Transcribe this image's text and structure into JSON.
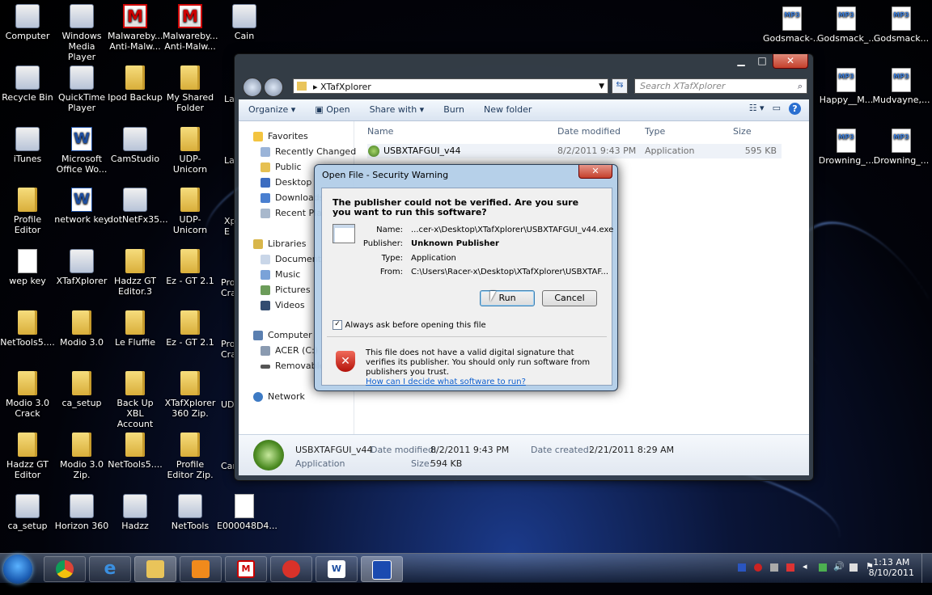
{
  "desktop": {
    "icons": [
      {
        "label": "Computer",
        "kind": "app"
      },
      {
        "label": "Windows Media Player",
        "kind": "app"
      },
      {
        "label": "Malwareby... Anti-Malw...",
        "kind": "red"
      },
      {
        "label": "Malwareby... Anti-Malw...",
        "kind": "red"
      },
      {
        "label": "Cain",
        "kind": "app"
      },
      {
        "label": "Recycle Bin",
        "kind": "app"
      },
      {
        "label": "QuickTime Player",
        "kind": "app"
      },
      {
        "label": "Ipod Backup",
        "kind": "folder"
      },
      {
        "label": "My Shared Folder",
        "kind": "folder"
      },
      {
        "label": "iTunes",
        "kind": "app"
      },
      {
        "label": "Microsoft Office Wo...",
        "kind": "word"
      },
      {
        "label": "CamStudio",
        "kind": "app"
      },
      {
        "label": "UDP-Unicorn",
        "kind": "folder"
      },
      {
        "label": "Profile Editor",
        "kind": "folder"
      },
      {
        "label": "network key",
        "kind": "word"
      },
      {
        "label": "dotNetFx35...",
        "kind": "app"
      },
      {
        "label": "UDP-Unicorn",
        "kind": "folder"
      },
      {
        "label": "wep key",
        "kind": "doc"
      },
      {
        "label": "XTafXplorer",
        "kind": "app"
      },
      {
        "label": "Hadzz GT Editor.3",
        "kind": "folder"
      },
      {
        "label": "Ez - GT 2.1",
        "kind": "folder"
      },
      {
        "label": "NetTools5....",
        "kind": "folder"
      },
      {
        "label": "Modio 3.0",
        "kind": "folder"
      },
      {
        "label": "Le Fluffie",
        "kind": "folder"
      },
      {
        "label": "Ez - GT 2.1",
        "kind": "folder"
      },
      {
        "label": "Modio 3.0 Crack",
        "kind": "folder"
      },
      {
        "label": "ca_setup",
        "kind": "folder"
      },
      {
        "label": "Back Up XBL Account",
        "kind": "folder"
      },
      {
        "label": "XTafXplorer 360 Zip.",
        "kind": "folder"
      },
      {
        "label": "Hadzz GT Editor",
        "kind": "folder"
      },
      {
        "label": "Modio 3.0 Zip.",
        "kind": "folder"
      },
      {
        "label": "NetTools5....",
        "kind": "folder"
      },
      {
        "label": "Profile Editor Zip.",
        "kind": "folder"
      },
      {
        "label": "ca_setup",
        "kind": "app"
      },
      {
        "label": "Horizon 360",
        "kind": "app"
      },
      {
        "label": "Hadzz",
        "kind": "app"
      },
      {
        "label": "NetTools",
        "kind": "app"
      },
      {
        "label": "E000048D4...",
        "kind": "doc"
      }
    ],
    "partial_labels": [
      "La",
      "La",
      "Xp E",
      "Pro Cra",
      "Pro Cra",
      "UD",
      "Car"
    ],
    "right_icons": [
      {
        "label": "Godsmack-..."
      },
      {
        "label": "Godsmack_..."
      },
      {
        "label": "Godsmack..."
      },
      {
        "label": "Happy__M..."
      },
      {
        "label": "Mudvayne,..."
      },
      {
        "label": "Drowning_..."
      },
      {
        "label": "Drowning_..."
      }
    ]
  },
  "explorer": {
    "address": "XTafXplorer",
    "search_placeholder": "Search XTafXplorer",
    "toolbar": {
      "organize": "Organize",
      "open": "Open",
      "share": "Share with",
      "burn": "Burn",
      "new_folder": "New folder"
    },
    "nav": {
      "favorites": "Favorites",
      "recently_changed": "Recently Changed",
      "public": "Public",
      "desktop": "Desktop",
      "downloads": "Downloads",
      "recent_places": "Recent Places",
      "libraries": "Libraries",
      "documents": "Documents",
      "music": "Music",
      "pictures": "Pictures",
      "videos": "Videos",
      "computer": "Computer",
      "acer": "ACER (C:)",
      "removable": "Removable Disk",
      "network": "Network"
    },
    "columns": {
      "name": "Name",
      "date": "Date modified",
      "type": "Type",
      "size": "Size"
    },
    "file": {
      "name": "USBXTAFGUI_v44",
      "date": "8/2/2011 9:43 PM",
      "type": "Application",
      "size": "595 KB"
    },
    "details": {
      "name": "USBXTAFGUI_v44",
      "kind": "Application",
      "date_modified_label": "Date modified:",
      "date_modified": "8/2/2011 9:43 PM",
      "date_created_label": "Date created:",
      "date_created": "2/21/2011 8:29 AM",
      "size_label": "Size:",
      "size": "594 KB"
    }
  },
  "dialog": {
    "title": "Open File - Security Warning",
    "question": "The publisher could not be verified.  Are you sure you want to run this software?",
    "name_label": "Name:",
    "name_value": "...cer-x\\Desktop\\XTafXplorer\\USBXTAFGUI_v44.exe",
    "publisher_label": "Publisher:",
    "publisher_value": "Unknown Publisher",
    "type_label": "Type:",
    "type_value": "Application",
    "from_label": "From:",
    "from_value": "C:\\Users\\Racer-x\\Desktop\\XTafXplorer\\USBXTAF...",
    "run": "Run",
    "cancel": "Cancel",
    "checkbox": "Always ask before opening this file",
    "warning": "This file does not have a valid digital signature that verifies its publisher.  You should only run software from publishers you trust.",
    "link": "How can I decide what software to run?"
  },
  "taskbar": {
    "time": "1:13 AM",
    "date": "8/10/2011"
  }
}
